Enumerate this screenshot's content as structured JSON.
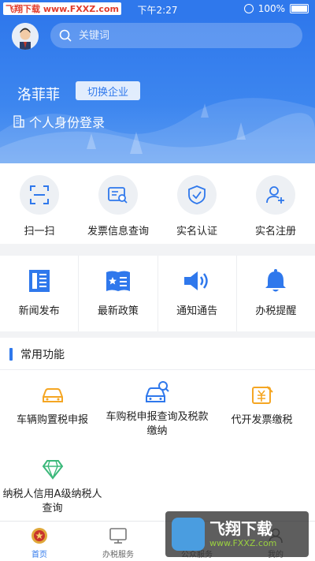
{
  "status_bar": {
    "watermark": "飞翔下载 www.FXXZ.com",
    "time": "下午2:27",
    "battery": "100%"
  },
  "header": {
    "search_placeholder": "关键词",
    "username": "洛菲菲",
    "switch_label": "切换企业",
    "login_text": "个人身份登录"
  },
  "quick_actions": [
    {
      "label": "扫一扫",
      "icon": "scan-icon"
    },
    {
      "label": "发票信息查询",
      "icon": "invoice-search-icon"
    },
    {
      "label": "实名认证",
      "icon": "shield-check-icon"
    },
    {
      "label": "实名注册",
      "icon": "user-add-icon"
    }
  ],
  "news_items": [
    {
      "label": "新闻发布",
      "icon": "newspaper-icon"
    },
    {
      "label": "最新政策",
      "icon": "policy-icon"
    },
    {
      "label": "通知通告",
      "icon": "speaker-icon"
    },
    {
      "label": "办税提醒",
      "icon": "bell-icon"
    }
  ],
  "common_functions": {
    "title": "常用功能",
    "items": [
      {
        "label": "车辆购置税申报",
        "icon": "car-icon"
      },
      {
        "label": "车购税申报查询及税款缴纳",
        "icon": "car-search-icon"
      },
      {
        "label": "代开发票缴税",
        "icon": "invoice-tax-icon"
      },
      {
        "label": "纳税人信用A级纳税人查询",
        "icon": "diamond-icon"
      }
    ]
  },
  "tabs": [
    {
      "label": "首页",
      "icon": "home-emblem-icon",
      "active": true
    },
    {
      "label": "办税服务",
      "icon": "monitor-icon",
      "active": false
    },
    {
      "label": "公众服务",
      "icon": "public-icon",
      "active": false
    },
    {
      "label": "我的",
      "icon": "profile-icon",
      "active": false
    }
  ],
  "overlay_watermark": {
    "title": "飞翔下载",
    "url": "www.FXXZ.com"
  },
  "colors": {
    "primary": "#2f78ec",
    "accent_orange": "#f5a623",
    "accent_green": "#3bb87a"
  }
}
